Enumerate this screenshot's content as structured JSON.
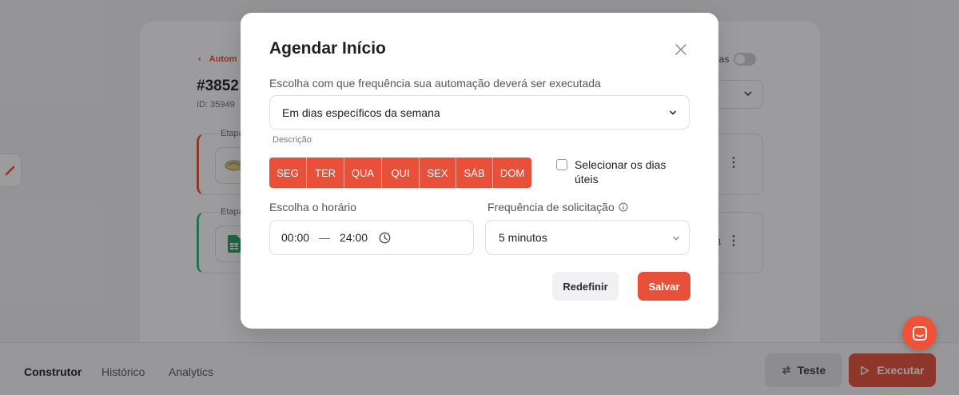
{
  "background": {
    "breadcrumb": {
      "chevron": "‹",
      "label": "Autom"
    },
    "flow_title": "#3852",
    "flow_id": "ID: 35949",
    "canvas_toggle_label": "nvas",
    "steps": [
      {
        "label": "Etapa",
        "icon": "handshake-icon",
        "meta": ""
      },
      {
        "label": "Etapa",
        "icon": "google-sheets-icon",
        "meta": "3"
      }
    ],
    "bottom_tabs": [
      "Construtor",
      "Histórico",
      "Analytics"
    ],
    "teste_label": "Teste",
    "executar_label": "Executar"
  },
  "modal": {
    "title": "Agendar Início",
    "frequency_label": "Escolha com que frequência sua automação deverá ser executada",
    "frequency_value": "Em dias específicos da semana",
    "description_label": "Descrição",
    "days": [
      "SEG",
      "TER",
      "QUA",
      "QUI",
      "SEX",
      "SÁB",
      "DOM"
    ],
    "weekdays_checkbox_label": "Selecionar os dias úteis",
    "time_label": "Escolha o horário",
    "time_start": "00:00",
    "time_separator": "—",
    "time_end": "24:00",
    "request_freq_label": "Frequência de solicitação",
    "request_freq_value": "5 minutos",
    "reset_label": "Redefinir",
    "save_label": "Salvar"
  },
  "colors": {
    "accent": "#e8503a",
    "overlay": "rgba(20,20,24,0.42)"
  }
}
